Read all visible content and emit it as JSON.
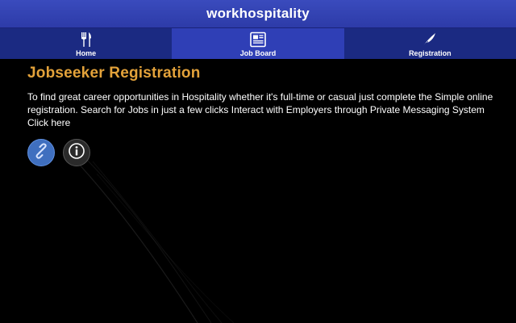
{
  "app": {
    "title": "workhospitality"
  },
  "nav": {
    "items": [
      {
        "label": "Home",
        "icon": "fork-knife-icon"
      },
      {
        "label": "Job Board",
        "icon": "newspaper-icon"
      },
      {
        "label": "Registration",
        "icon": "quill-icon"
      }
    ],
    "active": "Job Board"
  },
  "main": {
    "title": "Jobseeker Registration",
    "intro": "To find great career opportunities in Hospitality whether it's full-time or casual just complete the Simple online registration. Search for Jobs in just a few clicks Interact with Employers through Private Messaging System Click here",
    "actions": [
      {
        "icon": "link-icon"
      },
      {
        "icon": "info-icon"
      }
    ]
  },
  "colors": {
    "header": "#3a4bbd",
    "nav_active": "#2f3fb6",
    "nav_inactive": "#1b2a82",
    "title_accent": "#e3a23a",
    "background": "#000000",
    "link_button": "#3f6fbf"
  }
}
